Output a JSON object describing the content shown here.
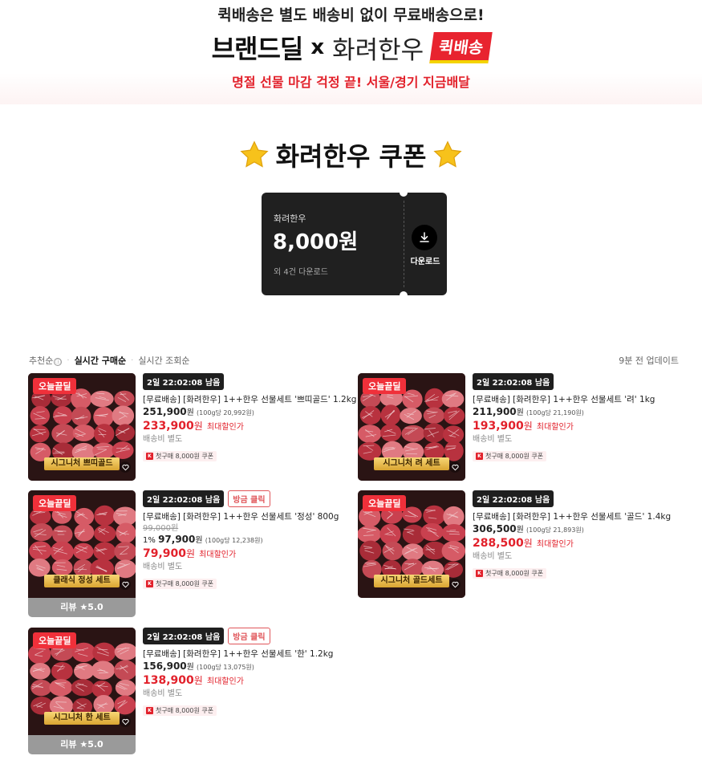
{
  "banner": {
    "line1": "퀵배송은 별도 배송비 없이 무료배송으로!",
    "brand_deal": "브랜드딜",
    "x": "x",
    "partner": "화려한우",
    "quick_badge": "퀵배송",
    "line3": "명절 선물 마감 걱정 끝! 서울/경기 지금배달"
  },
  "coupon_section": {
    "title": "화려한우 쿠폰",
    "card": {
      "brand": "화려한우",
      "amount": "8,000원",
      "extra": "외 4건 다운로드",
      "download_label": "다운로드"
    }
  },
  "sort": {
    "options": [
      "추천순",
      "실시간 구매순",
      "실시간 조회순"
    ],
    "info_icon": "ⓘ",
    "update_note": "9분 전 업데이트"
  },
  "products": [
    {
      "badge": "오늘끝딜",
      "thumb_label": "시그니처 쁘띠골드",
      "timer": "2일 22:02:08 남음",
      "hot": "",
      "name": "[무료배송] [화려한우] 1++한우 선물세트 '쁘띠골드' 1.2kg",
      "orig_price": "",
      "discount": "",
      "price": "251,900",
      "price_unit": "원",
      "unit_price": "(100g당 20,992원)",
      "sale_price": "233,900",
      "sale_unit": "원",
      "sale_label": "최대할인가",
      "shipping": "배송비 별도",
      "coupon": "첫구매 8,000원 쿠폰",
      "review": ""
    },
    {
      "badge": "오늘끝딜",
      "thumb_label": "시그니처 려 세트",
      "timer": "2일 22:02:08 남음",
      "hot": "",
      "name": "[무료배송] [화려한우] 1++한우 선물세트 '려' 1kg",
      "orig_price": "",
      "discount": "",
      "price": "211,900",
      "price_unit": "원",
      "unit_price": "(100g당 21,190원)",
      "sale_price": "193,900",
      "sale_unit": "원",
      "sale_label": "최대할인가",
      "shipping": "배송비 별도",
      "coupon": "첫구매 8,000원 쿠폰",
      "review": ""
    },
    {
      "badge": "오늘끝딜",
      "thumb_label": "클래식 정성 세트",
      "timer": "2일 22:02:08 남음",
      "hot": "방금 클릭",
      "name": "[무료배송] [화려한우] 1++한우 선물세트 '정성' 800g",
      "orig_price": "99,000원",
      "discount": "1%",
      "price": "97,900",
      "price_unit": "원",
      "unit_price": "(100g당 12,238원)",
      "sale_price": "79,900",
      "sale_unit": "원",
      "sale_label": "최대할인가",
      "shipping": "배송비 별도",
      "coupon": "첫구매 8,000원 쿠폰",
      "review": "리뷰 ★5.0"
    },
    {
      "badge": "오늘끝딜",
      "thumb_label": "시그니처 골드세트",
      "timer": "2일 22:02:08 남음",
      "hot": "",
      "name": "[무료배송] [화려한우] 1++한우 선물세트 '골드' 1.4kg",
      "orig_price": "",
      "discount": "",
      "price": "306,500",
      "price_unit": "원",
      "unit_price": "(100g당 21,893원)",
      "sale_price": "288,500",
      "sale_unit": "원",
      "sale_label": "최대할인가",
      "shipping": "배송비 별도",
      "coupon": "첫구매 8,000원 쿠폰",
      "review": ""
    },
    {
      "badge": "오늘끝딜",
      "thumb_label": "시그니처 한 세트",
      "timer": "2일 22:02:08 남음",
      "hot": "방금 클릭",
      "name": "[무료배송] [화려한우] 1++한우 선물세트 '한' 1.2kg",
      "orig_price": "",
      "discount": "",
      "price": "156,900",
      "price_unit": "원",
      "unit_price": "(100g당 13,075원)",
      "sale_price": "138,900",
      "sale_unit": "원",
      "sale_label": "최대할인가",
      "shipping": "배송비 별도",
      "coupon": "첫구매 8,000원 쿠폰",
      "review": "리뷰 ★5.0"
    }
  ],
  "icons": {
    "star": "star-icon",
    "download": "download-icon",
    "heart": "heart-icon",
    "info": "info-icon",
    "coupon_mark": "k-mark-icon"
  },
  "colors": {
    "accent_red": "#e2212b",
    "coupon_bg": "#202020",
    "timer_bg": "#1f1f1f",
    "gold": "#d9a431"
  }
}
